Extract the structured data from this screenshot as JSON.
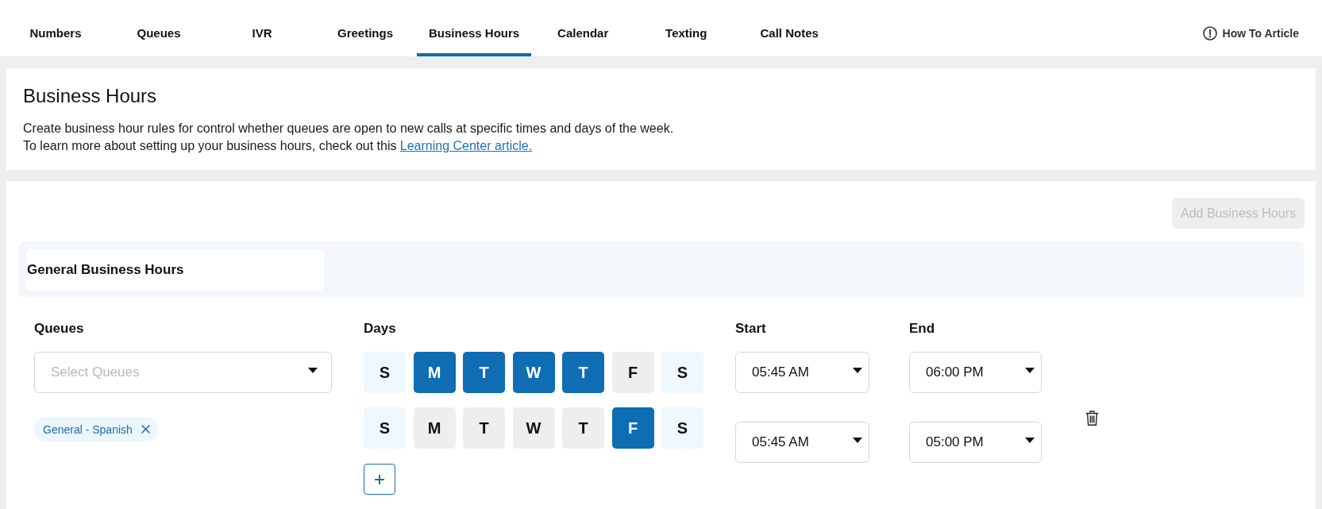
{
  "nav": {
    "tabs": [
      {
        "label": "Numbers",
        "selected": false
      },
      {
        "label": "Queues",
        "selected": false
      },
      {
        "label": "IVR",
        "selected": false
      },
      {
        "label": "Greetings",
        "selected": false
      },
      {
        "label": "Business Hours",
        "selected": true
      },
      {
        "label": "Calendar",
        "selected": false
      },
      {
        "label": "Texting",
        "selected": false
      },
      {
        "label": "Call Notes",
        "selected": false
      }
    ],
    "help_link": {
      "label": "How To Article"
    }
  },
  "intro": {
    "title": "Business Hours",
    "description": "Create business hour rules for control whether queues are open to new calls at specific times and days of the week.",
    "learn_more": {
      "text": "To learn more about setting up your business hours, check out this",
      "link": "Learning Center article."
    }
  },
  "add_button": {
    "label": "Add Business Hours",
    "disabled": true
  },
  "rule": {
    "name": "General Business Hours",
    "columns": {
      "queues": "Queues",
      "days": "Days",
      "start": "Start",
      "end": "End"
    },
    "queue_select": {
      "placeholder": "Select Queues"
    },
    "queue_tags": [
      {
        "label": "General - Spanish"
      }
    ],
    "schedules": [
      {
        "days": [
          {
            "label": "S",
            "kind": "weekend",
            "selected": false
          },
          {
            "label": "M",
            "kind": "weekday",
            "selected": true
          },
          {
            "label": "T",
            "kind": "weekday",
            "selected": true
          },
          {
            "label": "W",
            "kind": "weekday",
            "selected": true
          },
          {
            "label": "T",
            "kind": "weekday",
            "selected": true
          },
          {
            "label": "F",
            "kind": "weekday",
            "selected": false
          },
          {
            "label": "S",
            "kind": "weekend",
            "selected": false
          }
        ],
        "start": "05:45 AM",
        "end": "06:00 PM"
      },
      {
        "days": [
          {
            "label": "S",
            "kind": "weekend",
            "selected": false
          },
          {
            "label": "M",
            "kind": "weekday",
            "selected": false
          },
          {
            "label": "T",
            "kind": "weekday",
            "selected": false
          },
          {
            "label": "W",
            "kind": "weekday",
            "selected": false
          },
          {
            "label": "T",
            "kind": "weekday",
            "selected": false
          },
          {
            "label": "F",
            "kind": "weekday",
            "selected": true
          },
          {
            "label": "S",
            "kind": "weekend",
            "selected": false
          }
        ],
        "start": "05:45 AM",
        "end": "05:00 PM"
      }
    ]
  }
}
